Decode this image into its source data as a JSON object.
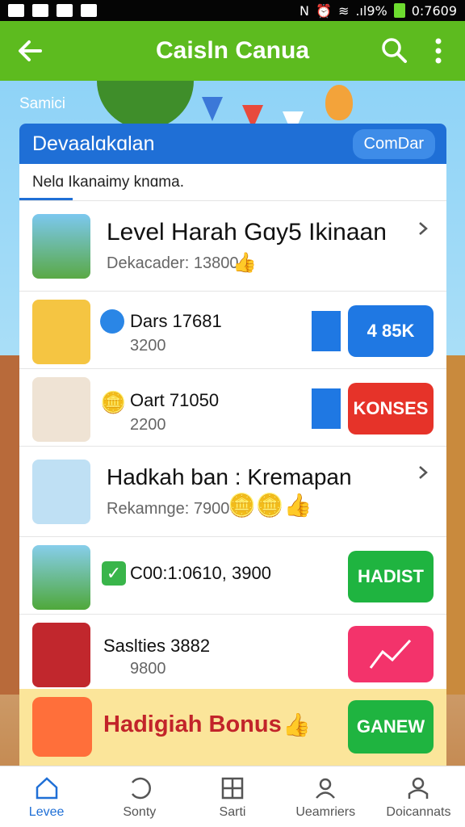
{
  "status_bar": {
    "battery": ".ıl9%",
    "time": "0:7609"
  },
  "app_bar": {
    "title": "Caisln Canua"
  },
  "scene": {
    "label": "Samici"
  },
  "panel": {
    "title": "Devaalɑkɑlan",
    "header_button": "ComDar",
    "subtab": "Nelɑ Ikanaimy knɑma."
  },
  "rows": [
    {
      "title": "Level Harah Gɑy5 Ikinaan",
      "subtitle": "Dekacader: 13800"
    },
    {
      "title": "Dars 17681",
      "subtitle": "3200",
      "button": "4 85K"
    },
    {
      "title": "Oart 71050",
      "subtitle": "2200",
      "button": "KONSES"
    },
    {
      "title": "Hadkah ban : Kremapan",
      "subtitle": "Rekamnge: 7900"
    },
    {
      "title": "C00:1:0610, 3900",
      "button": "HADIST"
    },
    {
      "title": "Saslties 3882",
      "subtitle": "9800"
    }
  ],
  "bonus": {
    "label": "Hadigiah Bonus",
    "button": "GANEW"
  },
  "bottom_nav": [
    {
      "label": "Levee"
    },
    {
      "label": "Sonty"
    },
    {
      "label": "Sarti"
    },
    {
      "label": "Ueamriers"
    },
    {
      "label": "Doicannats"
    }
  ],
  "colors": {
    "app_bar": "#5dbb1f",
    "panel_header": "#1f6fd6",
    "blue_button": "#1f78e3",
    "red_button": "#e63329",
    "green_button": "#1fb440",
    "pink_button": "#f3336b"
  }
}
